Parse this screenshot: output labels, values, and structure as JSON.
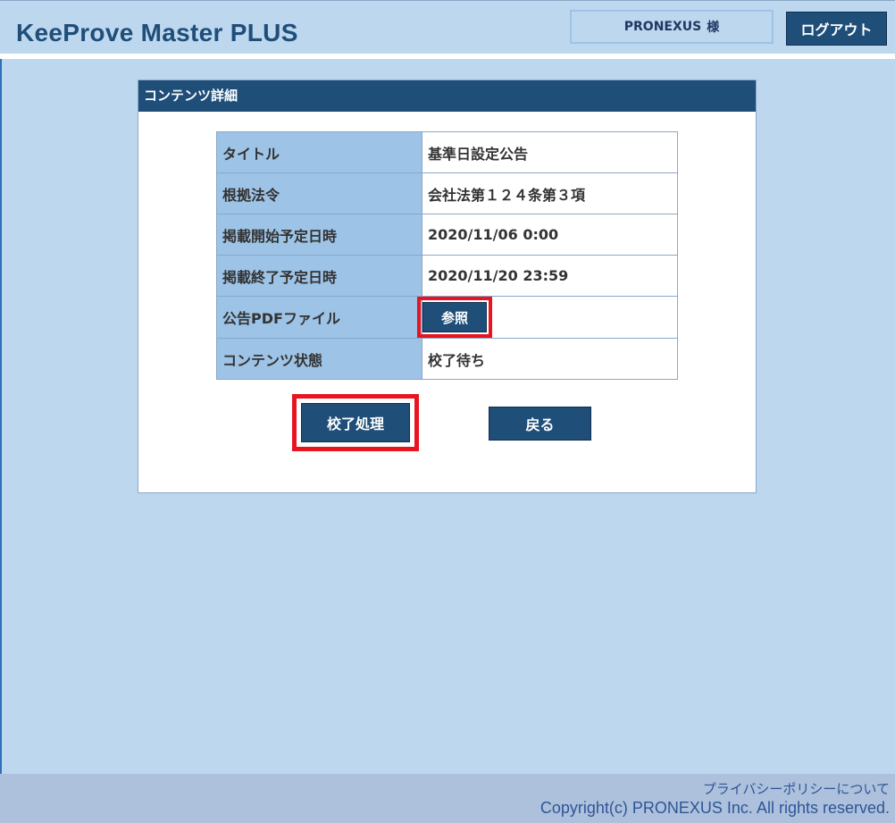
{
  "header": {
    "app_title": "KeeProve Master PLUS",
    "user_name": "PRONEXUS",
    "user_suffix": "様",
    "logout_label": "ログアウト"
  },
  "panel": {
    "title": "コンテンツ詳細",
    "rows": [
      {
        "label": "タイトル",
        "value": "基準日設定公告"
      },
      {
        "label": "根拠法令",
        "value": "会社法第１２４条第３項"
      },
      {
        "label": "掲載開始予定日時",
        "value": "2020/11/06 0:00"
      },
      {
        "label": "掲載終了予定日時",
        "value": "2020/11/20 23:59"
      },
      {
        "label": "公告PDFファイル",
        "button": "参照"
      },
      {
        "label": "コンテンツ状態",
        "value": "校了待ち"
      }
    ],
    "proof_button": "校了処理",
    "back_button": "戻る"
  },
  "footer": {
    "privacy_link": "プライバシーポリシーについて",
    "copyright": "Copyright(c) PRONEXUS Inc. All rights reserved."
  },
  "colors": {
    "background": "#bdd7ee",
    "brand_navy": "#1f4e79",
    "label_cell": "#9dc3e6",
    "highlight_red": "#e8141f"
  }
}
